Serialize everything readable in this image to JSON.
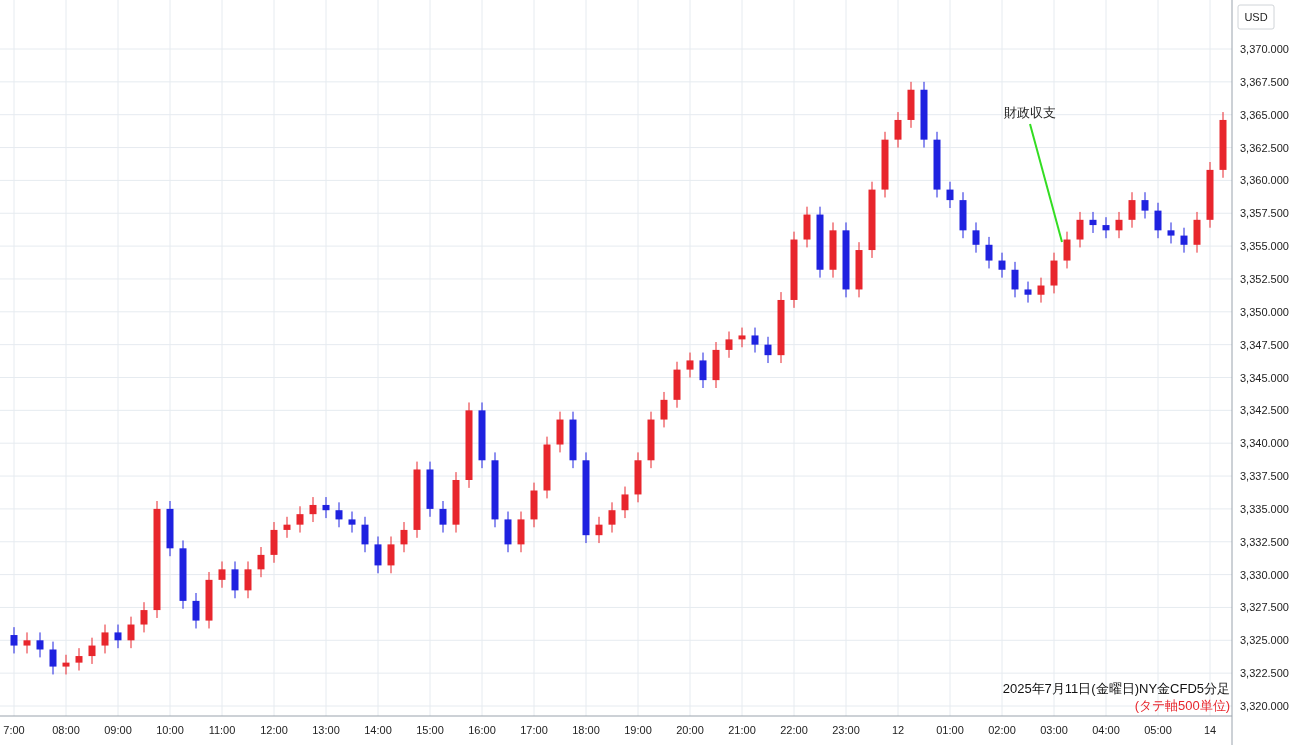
{
  "axis_currency": "USD",
  "chart_data": {
    "type": "candlestick",
    "grid": true,
    "ylim": [
      3320,
      3370
    ],
    "yticks": [
      {
        "value": 3320,
        "label": "3,320.000"
      },
      {
        "value": 3322.5,
        "label": "3,322.500"
      },
      {
        "value": 3325,
        "label": "3,325.000"
      },
      {
        "value": 3327.5,
        "label": "3,327.500"
      },
      {
        "value": 3330,
        "label": "3,330.000"
      },
      {
        "value": 3332.5,
        "label": "3,332.500"
      },
      {
        "value": 3335,
        "label": "3,335.000"
      },
      {
        "value": 3337.5,
        "label": "3,337.500"
      },
      {
        "value": 3340,
        "label": "3,340.000"
      },
      {
        "value": 3342.5,
        "label": "3,342.500"
      },
      {
        "value": 3345,
        "label": "3,345.000"
      },
      {
        "value": 3347.5,
        "label": "3,347.500"
      },
      {
        "value": 3350,
        "label": "3,350.000"
      },
      {
        "value": 3352.5,
        "label": "3,352.500"
      },
      {
        "value": 3355,
        "label": "3,355.000"
      },
      {
        "value": 3357.5,
        "label": "3,357.500"
      },
      {
        "value": 3360,
        "label": "3,360.000"
      },
      {
        "value": 3362.5,
        "label": "3,362.500"
      },
      {
        "value": 3365,
        "label": "3,365.000"
      },
      {
        "value": 3367.5,
        "label": "3,367.500"
      },
      {
        "value": 3370,
        "label": "3,370.000"
      }
    ],
    "categories": [
      "7:00",
      null,
      null,
      null,
      "08:00",
      null,
      null,
      null,
      "09:00",
      null,
      null,
      null,
      "10:00",
      null,
      null,
      null,
      "11:00",
      null,
      null,
      null,
      "12:00",
      null,
      null,
      null,
      "13:00",
      null,
      null,
      null,
      "14:00",
      null,
      null,
      null,
      "15:00",
      null,
      null,
      null,
      "16:00",
      null,
      null,
      null,
      "17:00",
      null,
      null,
      null,
      "18:00",
      null,
      null,
      null,
      "19:00",
      null,
      null,
      null,
      "20:00",
      null,
      null,
      null,
      "21:00",
      null,
      null,
      null,
      "22:00",
      null,
      null,
      null,
      "23:00",
      null,
      null,
      null,
      "12",
      null,
      null,
      null,
      "01:00",
      null,
      null,
      null,
      "02:00",
      null,
      null,
      null,
      "03:00",
      null,
      null,
      null,
      "04:00",
      null,
      null,
      null,
      "05:00",
      null,
      null,
      null,
      "14",
      null
    ],
    "ohlc": [
      [
        3325.4,
        3326.0,
        3324.0,
        3324.6
      ],
      [
        3324.6,
        3325.6,
        3324.0,
        3325.0
      ],
      [
        3325.0,
        3325.6,
        3323.7,
        3324.3
      ],
      [
        3324.3,
        3324.9,
        3322.4,
        3323.0
      ],
      [
        3323.0,
        3323.9,
        3322.4,
        3323.3
      ],
      [
        3323.3,
        3324.4,
        3322.7,
        3323.8
      ],
      [
        3323.8,
        3325.2,
        3323.2,
        3324.6
      ],
      [
        3324.6,
        3326.2,
        3324.0,
        3325.6
      ],
      [
        3325.6,
        3326.2,
        3324.4,
        3325.0
      ],
      [
        3325.0,
        3326.8,
        3324.4,
        3326.2
      ],
      [
        3326.2,
        3327.9,
        3325.6,
        3327.3
      ],
      [
        3327.3,
        3335.6,
        3326.7,
        3335.0
      ],
      [
        3335.0,
        3335.6,
        3331.4,
        3332.0
      ],
      [
        3332.0,
        3332.6,
        3327.4,
        3328.0
      ],
      [
        3328.0,
        3328.6,
        3325.9,
        3326.5
      ],
      [
        3326.5,
        3330.2,
        3325.9,
        3329.6
      ],
      [
        3329.6,
        3331.0,
        3329.0,
        3330.4
      ],
      [
        3330.4,
        3331.0,
        3328.2,
        3328.8
      ],
      [
        3328.8,
        3331.0,
        3328.2,
        3330.4
      ],
      [
        3330.4,
        3332.1,
        3329.8,
        3331.5
      ],
      [
        3331.5,
        3334.0,
        3330.9,
        3333.4
      ],
      [
        3333.4,
        3334.4,
        3332.8,
        3333.8
      ],
      [
        3333.8,
        3335.2,
        3333.2,
        3334.6
      ],
      [
        3334.6,
        3335.9,
        3334.0,
        3335.3
      ],
      [
        3335.3,
        3335.9,
        3334.3,
        3334.9
      ],
      [
        3334.9,
        3335.5,
        3333.6,
        3334.2
      ],
      [
        3334.2,
        3334.8,
        3333.2,
        3333.8
      ],
      [
        3333.8,
        3334.4,
        3331.7,
        3332.3
      ],
      [
        3332.3,
        3332.9,
        3330.1,
        3330.7
      ],
      [
        3330.7,
        3332.9,
        3330.1,
        3332.3
      ],
      [
        3332.3,
        3334.0,
        3331.7,
        3333.4
      ],
      [
        3333.4,
        3338.6,
        3332.8,
        3338.0
      ],
      [
        3338.0,
        3338.6,
        3334.4,
        3335.0
      ],
      [
        3335.0,
        3335.6,
        3333.2,
        3333.8
      ],
      [
        3333.8,
        3337.8,
        3333.2,
        3337.2
      ],
      [
        3337.2,
        3343.1,
        3336.6,
        3342.5
      ],
      [
        3342.5,
        3343.1,
        3338.1,
        3338.7
      ],
      [
        3338.7,
        3339.3,
        3333.6,
        3334.2
      ],
      [
        3334.2,
        3334.8,
        3331.7,
        3332.3
      ],
      [
        3332.3,
        3334.8,
        3331.7,
        3334.2
      ],
      [
        3334.2,
        3337.0,
        3333.6,
        3336.4
      ],
      [
        3336.4,
        3340.5,
        3335.8,
        3339.9
      ],
      [
        3339.9,
        3342.4,
        3339.3,
        3341.8
      ],
      [
        3341.8,
        3342.4,
        3338.1,
        3338.7
      ],
      [
        3338.7,
        3339.3,
        3332.4,
        3333.0
      ],
      [
        3333.0,
        3334.4,
        3332.4,
        3333.8
      ],
      [
        3333.8,
        3335.5,
        3333.2,
        3334.9
      ],
      [
        3334.9,
        3336.7,
        3334.3,
        3336.1
      ],
      [
        3336.1,
        3339.3,
        3335.5,
        3338.7
      ],
      [
        3338.7,
        3342.4,
        3338.1,
        3341.8
      ],
      [
        3341.8,
        3343.9,
        3341.2,
        3343.3
      ],
      [
        3343.3,
        3346.2,
        3342.7,
        3345.6
      ],
      [
        3345.6,
        3346.9,
        3345.0,
        3346.3
      ],
      [
        3346.3,
        3346.9,
        3344.2,
        3344.8
      ],
      [
        3344.8,
        3347.7,
        3344.2,
        3347.1
      ],
      [
        3347.1,
        3348.5,
        3346.5,
        3347.9
      ],
      [
        3347.9,
        3348.8,
        3347.3,
        3348.2
      ],
      [
        3348.2,
        3348.8,
        3346.9,
        3347.5
      ],
      [
        3347.5,
        3348.1,
        3346.1,
        3346.7
      ],
      [
        3346.7,
        3351.5,
        3346.1,
        3350.9
      ],
      [
        3350.9,
        3356.1,
        3350.3,
        3355.5
      ],
      [
        3355.5,
        3358.0,
        3354.9,
        3357.4
      ],
      [
        3357.4,
        3358.0,
        3352.6,
        3353.2
      ],
      [
        3353.2,
        3356.8,
        3352.6,
        3356.2
      ],
      [
        3356.2,
        3356.8,
        3351.1,
        3351.7
      ],
      [
        3351.7,
        3355.3,
        3351.1,
        3354.7
      ],
      [
        3354.7,
        3359.9,
        3354.1,
        3359.3
      ],
      [
        3359.3,
        3363.7,
        3358.7,
        3363.1
      ],
      [
        3363.1,
        3365.2,
        3362.5,
        3364.6
      ],
      [
        3364.6,
        3367.5,
        3364.0,
        3366.9
      ],
      [
        3366.9,
        3367.5,
        3362.5,
        3363.1
      ],
      [
        3363.1,
        3363.7,
        3358.7,
        3359.3
      ],
      [
        3359.3,
        3359.9,
        3357.9,
        3358.5
      ],
      [
        3358.5,
        3359.1,
        3355.6,
        3356.2
      ],
      [
        3356.2,
        3356.8,
        3354.5,
        3355.1
      ],
      [
        3355.1,
        3355.7,
        3353.3,
        3353.9
      ],
      [
        3353.9,
        3354.5,
        3352.6,
        3353.2
      ],
      [
        3353.2,
        3353.8,
        3351.1,
        3351.7
      ],
      [
        3351.7,
        3352.3,
        3350.7,
        3351.3
      ],
      [
        3351.3,
        3352.6,
        3350.7,
        3352.0
      ],
      [
        3352.0,
        3354.5,
        3351.4,
        3353.9
      ],
      [
        3353.9,
        3356.1,
        3353.3,
        3355.5
      ],
      [
        3355.5,
        3357.6,
        3354.9,
        3357.0
      ],
      [
        3357.0,
        3357.6,
        3356.0,
        3356.6
      ],
      [
        3356.6,
        3357.2,
        3355.6,
        3356.2
      ],
      [
        3356.2,
        3357.6,
        3355.6,
        3357.0
      ],
      [
        3357.0,
        3359.1,
        3356.4,
        3358.5
      ],
      [
        3358.5,
        3359.1,
        3357.1,
        3357.7
      ],
      [
        3357.7,
        3358.3,
        3355.6,
        3356.2
      ],
      [
        3356.2,
        3356.8,
        3355.2,
        3355.8
      ],
      [
        3355.8,
        3356.4,
        3354.5,
        3355.1
      ],
      [
        3355.1,
        3357.6,
        3354.5,
        3357.0
      ],
      [
        3357.0,
        3361.4,
        3356.4,
        3360.8
      ],
      [
        3360.8,
        3365.2,
        3360.2,
        3364.6
      ]
    ],
    "annotations": [
      "財政収支"
    ]
  },
  "caption": "2025年7月11日(金曜日)NY金CFD5分足",
  "unit_note": "(タテ軸500単位)"
}
